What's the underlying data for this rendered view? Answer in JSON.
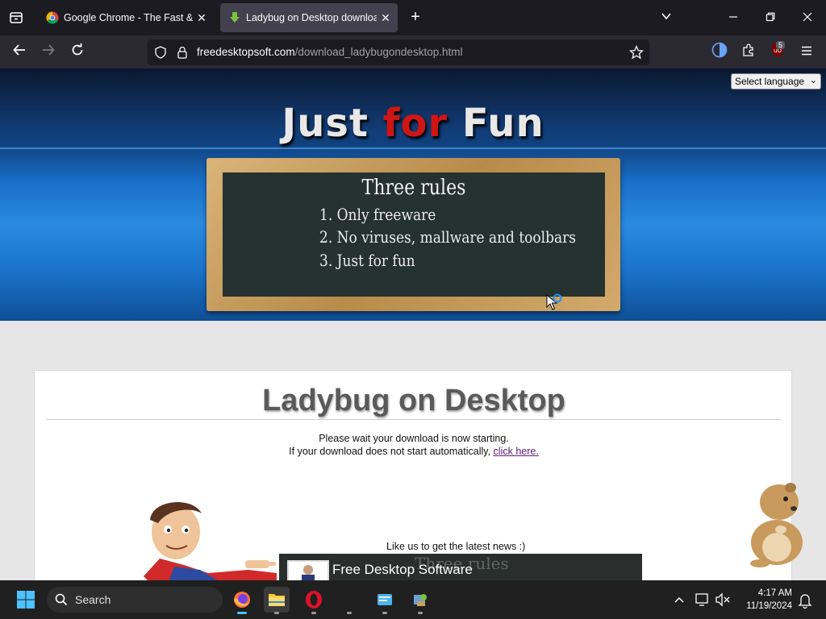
{
  "browser": {
    "tabs": [
      {
        "title": "Google Chrome - The Fast & Se",
        "favicon": "chrome-icon",
        "active": false
      },
      {
        "title": "Ladybug on Desktop download",
        "favicon": "download-arrow-icon",
        "active": true
      }
    ],
    "url_domain": "freedesktopsoft.com",
    "url_path": "/download_ladybugondesktop.html",
    "extension_badge": "5"
  },
  "page": {
    "language_select": "Select language",
    "site_title_part1": "Just ",
    "site_title_part2": "for",
    "site_title_part3": " Fun",
    "chalkboard": {
      "title": "Three rules",
      "rules": [
        "1. Only freeware",
        "2. No viruses, mallware and toolbars",
        "3. Just for fun"
      ]
    },
    "card_title": "Ladybug on Desktop",
    "wait_message": "Please wait your download is now starting.",
    "fallback_prefix": "If your download does not start automatically, ",
    "fallback_link": "click here.",
    "like_text": "Like us to get the latest news :)",
    "fb_page_name": "Free Desktop Software",
    "fb_bg_text": "Three rules"
  },
  "taskbar": {
    "search_label": "Search",
    "time": "4:17 AM",
    "date": "11/19/2024"
  },
  "colors": {
    "accent_red": "#d01515",
    "header_blue": "#1a6fc8",
    "link_purple": "#5a1a7a"
  }
}
